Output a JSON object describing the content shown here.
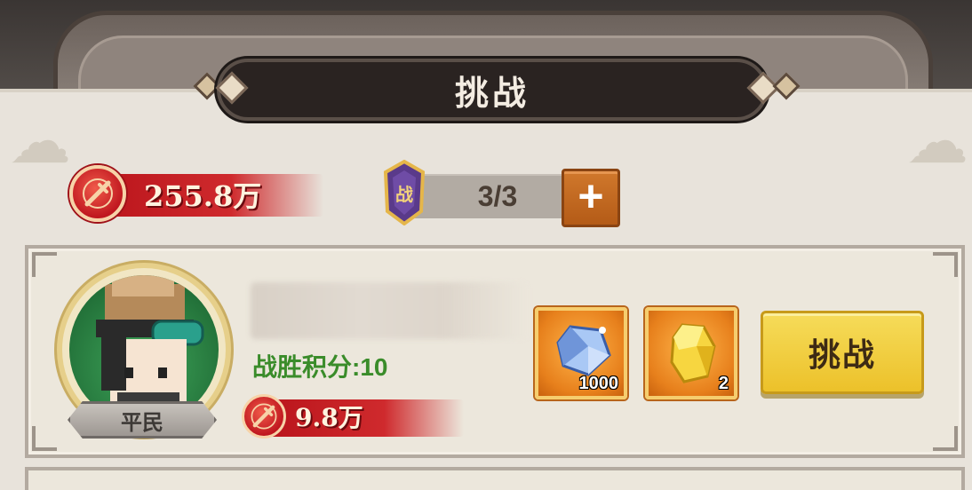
{
  "header": {
    "title": "挑战"
  },
  "resources": {
    "combat_power": "255.8万",
    "combat_power_icon": "sword-emblem-icon",
    "stamina": "3/3",
    "stamina_icon": "battle-token-icon",
    "add_button": "+"
  },
  "opponents": [
    {
      "rank": "平民",
      "score_label": "战胜积分:10",
      "combat_power": "9.8万",
      "rewards": [
        {
          "icon": "blue-crystal-icon",
          "count": "1000"
        },
        {
          "icon": "gold-ore-icon",
          "count": "2"
        }
      ],
      "action_label": "挑战"
    }
  ],
  "colors": {
    "panel_bg": "#e8e3db",
    "power_red": "#c0181f",
    "score_green": "#3a8c2a",
    "button_yellow": "#ecc12a",
    "plus_orange": "#c0661f"
  }
}
